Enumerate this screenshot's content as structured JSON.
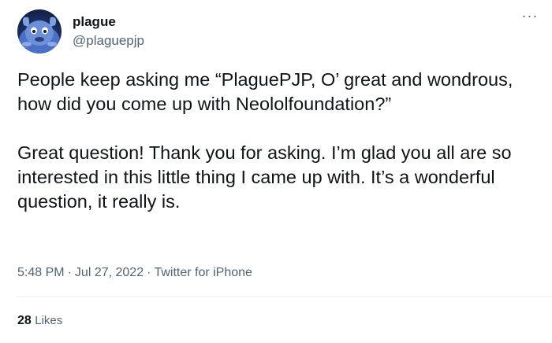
{
  "author": {
    "display_name": "plague",
    "handle": "@plaguepjp",
    "avatar_icon": "blue-furry-creature-avatar"
  },
  "tweet": {
    "paragraphs": [
      "People keep asking me “PlaguePJP, O’ great and wondrous, how did you come up with Neololfoundation?”",
      "Great question! Thank you for asking. I’m glad you all are so interested in this little thing I came up with. It’s a wonderful question, it really is."
    ],
    "time": "5:48 PM",
    "date": "Jul 27, 2022",
    "separator": "·",
    "source": "Twitter for iPhone"
  },
  "stats": {
    "likes_count": "28",
    "likes_label": "Likes"
  },
  "more_icon": "more-horizontal-icon",
  "colors": {
    "text_primary": "#0f1419",
    "text_secondary": "#536471",
    "divider": "#eff3f4"
  }
}
